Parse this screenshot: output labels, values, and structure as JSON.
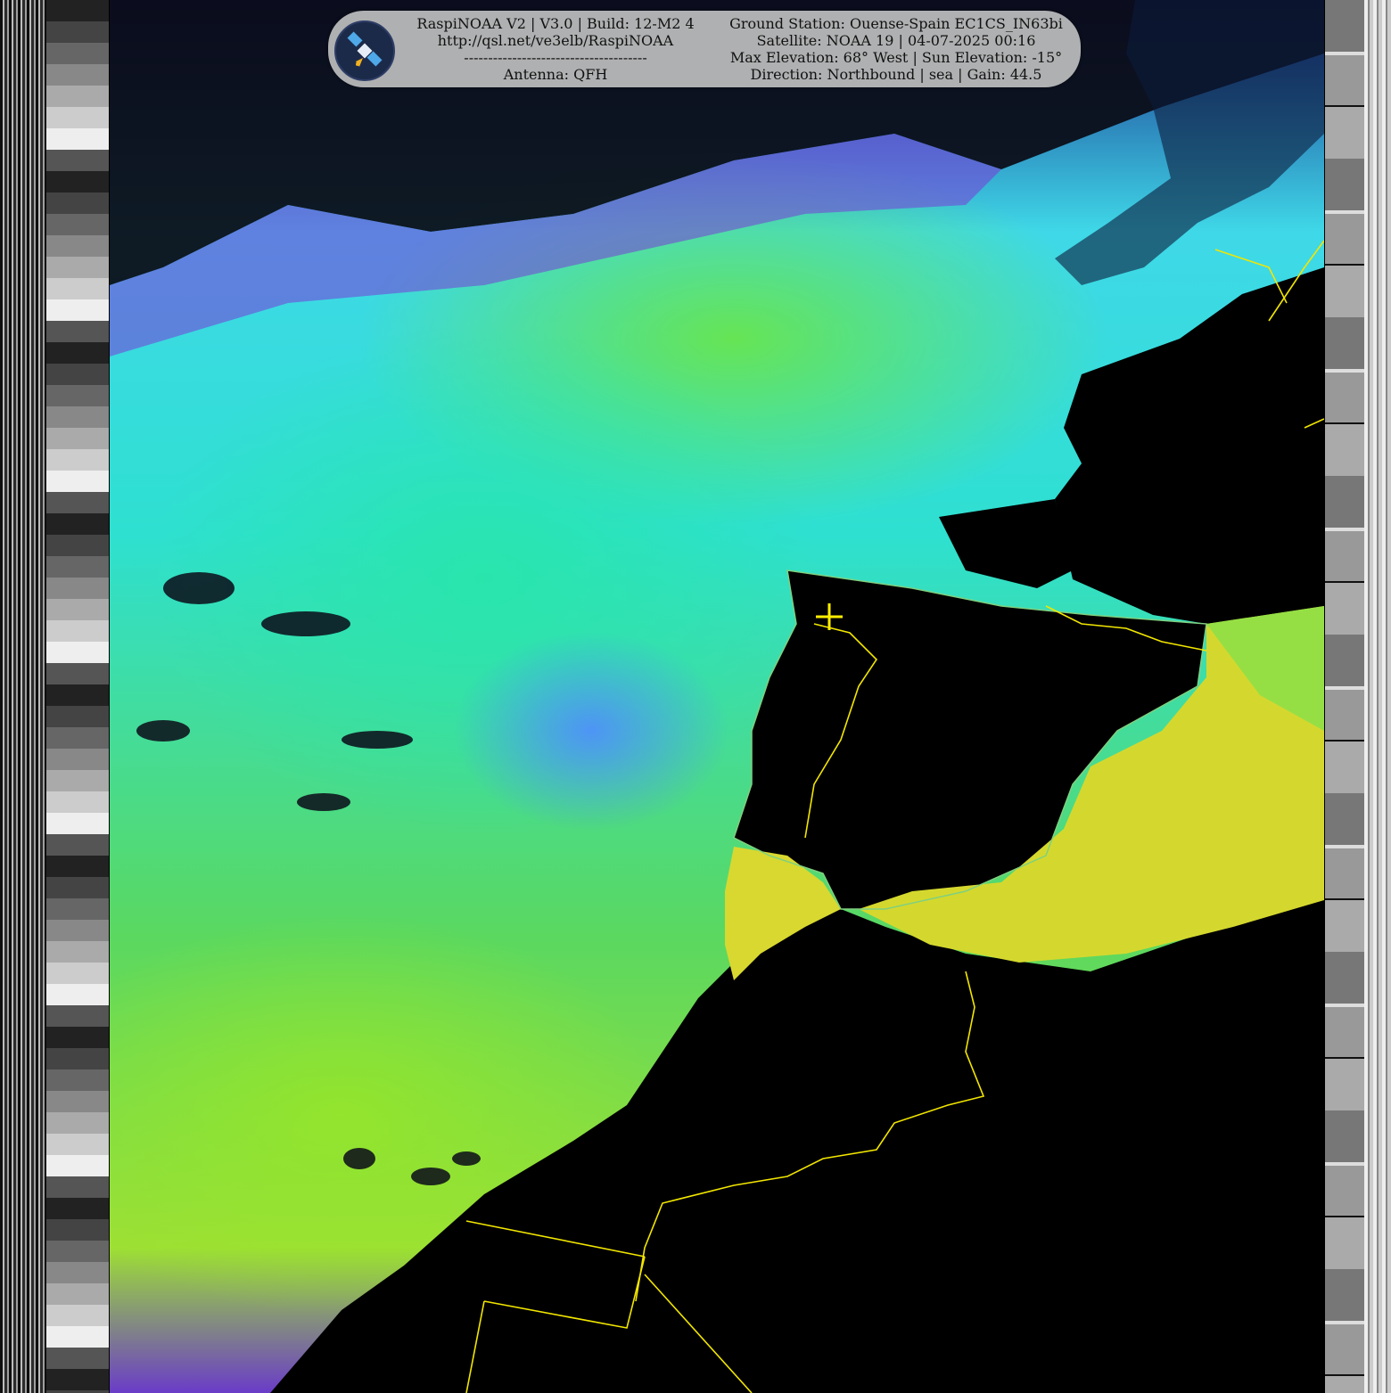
{
  "header": {
    "app_line": "RaspiNOAA V2 | V3.0 | Build: 12-M2 4",
    "url_line": "http://qsl.net/ve3elb/RaspiNOAA",
    "divider_line": "--------------------------------------",
    "antenna_line": "Antenna: QFH",
    "station_line": "Ground Station: Ouense-Spain EC1CS_IN63bi",
    "satellite_line": "Satellite: NOAA 19 | 04-07-2025 00:16",
    "elevation_line": "Max Elevation: 68° West | Sun Elevation: -15°",
    "direction_line": "Direction: Northbound | sea | Gain: 44.5"
  },
  "colors": {
    "land": "#000000",
    "border_lines": "#f2e600",
    "coastline": "#7fd07f",
    "header_bg": "#bebebe",
    "marker": "#ffee00"
  },
  "icons": {
    "logo": "satellite-logo-icon",
    "marker": "crosshair-icon"
  }
}
